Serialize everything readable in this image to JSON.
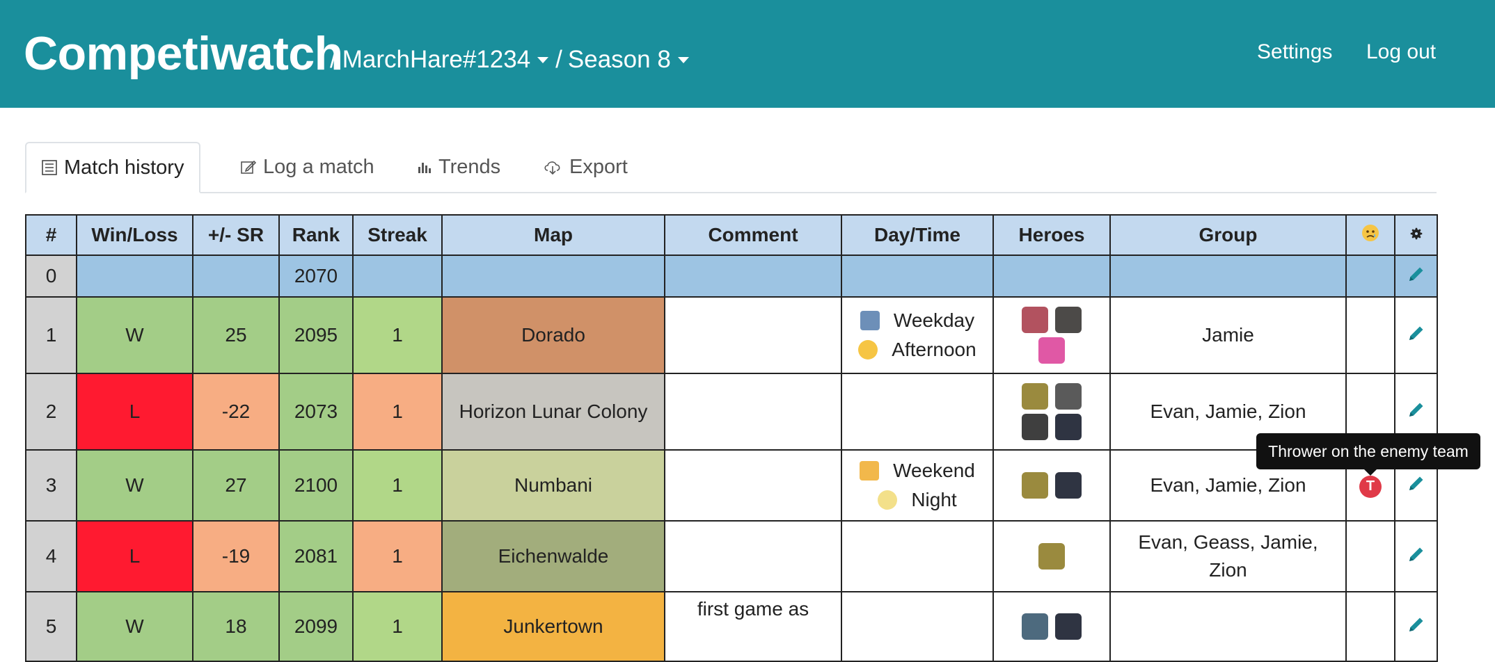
{
  "header": {
    "brand": "Competiwatch",
    "sep1": "/",
    "account": "MarchHare#1234",
    "sep2": "/",
    "season": "Season 8",
    "settings": "Settings",
    "logout": "Log out"
  },
  "tabs": [
    {
      "label": "Match history",
      "icon": "list-icon"
    },
    {
      "label": "Log a match",
      "icon": "edit-icon"
    },
    {
      "label": "Trends",
      "icon": "bar-chart-icon"
    },
    {
      "label": "Export",
      "icon": "cloud-download-icon"
    }
  ],
  "columns": {
    "num": "#",
    "winloss": "Win/Loss",
    "sr": "+/- SR",
    "rank": "Rank",
    "streak": "Streak",
    "map": "Map",
    "comment": "Comment",
    "daytime": "Day/Time",
    "heroes": "Heroes",
    "group": "Group",
    "flag_icon": "crying-face-icon",
    "settings_icon": "gear-icon"
  },
  "matches": [
    {
      "num": "0",
      "rank": "2070"
    },
    {
      "num": "1",
      "result": "W",
      "sr": "25",
      "rank": "2095",
      "streak": "1",
      "map": "Dorado",
      "map_color": "#d09168",
      "comment": "",
      "day": "Weekday",
      "day_icon": "necktie-emoji-icon",
      "time": "Afternoon",
      "time_icon": "sunglasses-emoji-icon",
      "heroes": [
        "dva",
        "roadhog",
        "zarya"
      ],
      "group": "Jamie"
    },
    {
      "num": "2",
      "result": "L",
      "sr": "-22",
      "rank": "2073",
      "streak": "1",
      "map": "Horizon Lunar Colony",
      "map_color": "#c7c5bf",
      "comment": "",
      "heroes": [
        "junkrat",
        "genji",
        "roadhog",
        "reaper"
      ],
      "group": "Evan, Jamie, Zion"
    },
    {
      "num": "3",
      "result": "W",
      "sr": "27",
      "rank": "2100",
      "streak": "1",
      "map": "Numbani",
      "map_color": "#c9d19c",
      "comment": "",
      "day": "Weekend",
      "day_icon": "party-popper-emoji-icon",
      "time": "Night",
      "time_icon": "moon-face-emoji-icon",
      "heroes": [
        "junkrat",
        "reaper"
      ],
      "group": "Evan, Jamie, Zion",
      "thrower": "T"
    },
    {
      "num": "4",
      "result": "L",
      "sr": "-19",
      "rank": "2081",
      "streak": "1",
      "map": "Eichenwalde",
      "map_color": "#a2ad7c",
      "comment": "",
      "heroes": [
        "junkrat"
      ],
      "group": "Evan, Geass, Jamie, Zion"
    },
    {
      "num": "5",
      "result": "W",
      "sr": "18",
      "rank": "2099",
      "streak": "1",
      "map": "Junkertown",
      "map_color": "#f3b342",
      "comment": "first game as",
      "heroes": [
        "soldier",
        "reaper"
      ],
      "group": ""
    }
  ],
  "tooltip": "Thrower on the enemy team",
  "colors": {
    "header_bg": "#1a8f9c",
    "win": "#a3cd87",
    "loss": "#ff1a30",
    "sr_negative": "#f7ad83",
    "table_header": "#c3d9ef",
    "row0": "#9dc4e3",
    "rank0": "#ffd770",
    "pencil": "#1a8f9c"
  }
}
